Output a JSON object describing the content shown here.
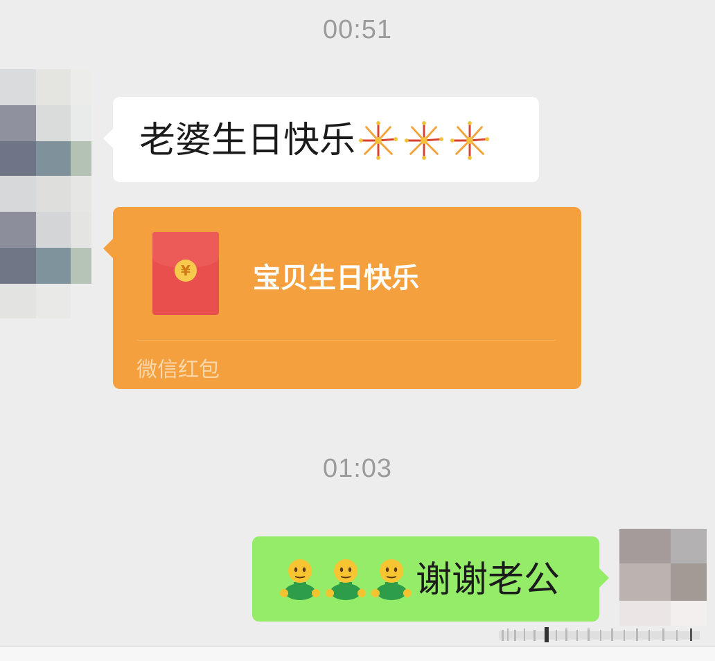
{
  "chat": {
    "timestamps": [
      "00:51",
      "01:03"
    ],
    "messages": [
      {
        "sender": "incoming",
        "type": "text",
        "text": "老婆生日快乐",
        "emojis": [
          "fireworks",
          "fireworks",
          "fireworks"
        ]
      },
      {
        "sender": "incoming",
        "type": "red_packet",
        "message": "宝贝生日快乐",
        "label": "微信红包",
        "currency_symbol": "¥"
      },
      {
        "sender": "outgoing",
        "type": "text",
        "text": "谢谢老公",
        "emojis": [
          "person-shrug",
          "person-shrug",
          "person-shrug"
        ]
      }
    ]
  },
  "colors": {
    "background": "#ededed",
    "incoming_bubble": "#ffffff",
    "outgoing_bubble": "#95ec69",
    "red_packet_bubble": "#f5a03e",
    "red_packet_icon": "#e9504d",
    "timestamp_text": "#9b9b9b"
  }
}
